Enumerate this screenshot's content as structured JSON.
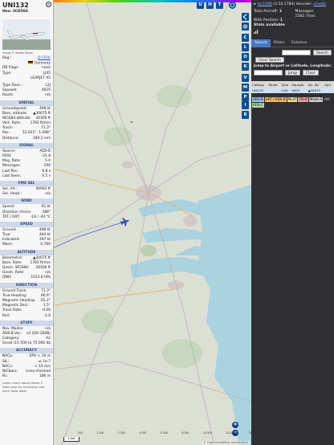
{
  "details": {
    "callsign": "UNI132",
    "hex_label": "Hex:",
    "hex": "3CD566",
    "close_label": "×",
    "photo_credit": "Image © Stefan Bauer",
    "registration": {
      "label": "Reg.:",
      "value": "D-CIOU"
    },
    "country": "Germany",
    "db_flags": {
      "label": "DB Flags:",
      "value": "none"
    },
    "type": {
      "label": "Type:",
      "value": "LJ45"
    },
    "type_name": "LEARJET 45",
    "type_desc": {
      "label": "Type Desc.:",
      "value": "L2J"
    },
    "squawk": {
      "label": "Squawk:",
      "value": "4625"
    },
    "route": {
      "label": "Route:",
      "value": "n/a"
    },
    "sections": {
      "spatial": "SPATIAL",
      "signal": "SIGNAL",
      "fms": "FMS SEL",
      "wind": "WIND",
      "speed": "SPEED",
      "altitude": "ALTITUDE",
      "direction": "DIRECTION",
      "stuff": "STUFF",
      "accuracy": "ACCURACY"
    },
    "spatial": [
      {
        "label": "Groundspeed:",
        "value": "498 kt"
      },
      {
        "label": "Baro. altitude:",
        "value": "▲30075 ft"
      },
      {
        "label": "WGS84 altitude:",
        "value": "30300 ft"
      },
      {
        "label": "Vert. Rate:",
        "value": "1792 ft/min"
      },
      {
        "label": "Track:",
        "value": "71.3°"
      },
      {
        "label": "Pos.:",
        "value": "52.021°, 1.098°"
      },
      {
        "label": "Distance:",
        "value": "189.2 nmi"
      }
    ],
    "signal": [
      {
        "label": "Source:",
        "value": "ADS-B"
      },
      {
        "label": "RSSI:",
        "value": "-21.8"
      },
      {
        "label": "Msg. Rate:",
        "value": "5.0"
      },
      {
        "label": "Messages:",
        "value": "296"
      },
      {
        "label": "Last Pos.:",
        "value": "6.8 s"
      },
      {
        "label": "Last Seen:",
        "value": "0.5 s"
      }
    ],
    "fms": [
      {
        "label": "Sel. Alt.:",
        "value": "40992 ft"
      },
      {
        "label": "Sel. Head.:",
        "value": "n/a"
      }
    ],
    "wind": [
      {
        "label": "Speed:",
        "value": "61 kt"
      },
      {
        "label": "Direction (from):",
        "value": "288°"
      },
      {
        "label": "TAT / OAT:",
        "value": "-16 / -44 °C"
      }
    ],
    "speed": [
      {
        "label": "Ground:",
        "value": "498 kt"
      },
      {
        "label": "True:",
        "value": "444 kt"
      },
      {
        "label": "Indicated:",
        "value": "297 kt"
      },
      {
        "label": "Mach:",
        "value": "0.760"
      }
    ],
    "altitude": [
      {
        "label": "Barometric:",
        "value": "▲30075 ft"
      },
      {
        "label": "Baro. Rate:",
        "value": "1792 ft/min"
      },
      {
        "label": "Geom. WGS84:",
        "value": "30300 ft"
      },
      {
        "label": "Geom. Rate:",
        "value": "n/a"
      },
      {
        "label": "QNH:",
        "value": "1013.6 hPa"
      }
    ],
    "direction": [
      {
        "label": "Ground Track:",
        "value": "71.3°"
      },
      {
        "label": "True Heading:",
        "value": "66.6°"
      },
      {
        "label": "Magnetic Heading:",
        "value": "65.2°"
      },
      {
        "label": "Magnetic Decl.:",
        "value": "1.5°"
      },
      {
        "label": "Track Rate:",
        "value": "-0.06"
      },
      {
        "label": "Roll:",
        "value": "-2.8"
      }
    ],
    "stuff": [
      {
        "label": "Nav. Modes:",
        "value": "n/a"
      },
      {
        "label": "ADS-B Ver.:",
        "value": "v2 (DO-260B)"
      },
      {
        "label": "Category:",
        "value": "A2"
      },
      {
        "label": "Small (15 500 to 75 000 lb)",
        "value": ""
      }
    ],
    "accuracy": [
      {
        "label": "NACp:",
        "value": "EPU < 10 m"
      },
      {
        "label": "SIL:",
        "value": "≤ 1e-7"
      },
      {
        "label": "NACv:",
        "value": "< 10 m/s"
      },
      {
        "label": "NICbaro:",
        "value": "cross-checked"
      },
      {
        "label": "Rc:",
        "value": "186 m"
      }
    ],
    "footer": "Learn more about Mode S data type by hovering over each data label."
  },
  "map": {
    "top_buttons": [
      "U",
      "H",
      "T"
    ],
    "side_buttons": [
      "C",
      "L",
      "O",
      "K",
      "V",
      "M",
      "P",
      "I",
      "R"
    ],
    "zoom_in": "+",
    "zoom_out": "−",
    "scale_label": "1 km",
    "attribution": "© OpenStreetMap contributors.",
    "altitude_scale_labels": [
      "500",
      "1 000",
      "2 000",
      "4 000",
      "6 000",
      "8 000",
      "10 000",
      "20 000",
      "30 000",
      "40 000+"
    ]
  },
  "stats": {
    "version_prefix": "tar1090",
    "version": "(3.14.1784)",
    "decoder_label": "decoder:",
    "decoder_value": "readsb",
    "total_aircraft_label": "Total Aircraft:",
    "total_aircraft": "1",
    "messages_label": "Messages:",
    "messages": "1582.7/sec",
    "with_position_label": "With Position:",
    "with_position": "1",
    "stats_label": "Stats available",
    "tabs": [
      "Search",
      "Filters",
      "Columns"
    ],
    "search_placeholder": "",
    "search_button": "Search",
    "clear_search_button": "Clear Search",
    "jump_label": "Jump to Airport or Latitude, Longitude:",
    "jump_button": "Jump",
    "clear_button": "Clear"
  },
  "table": {
    "headers": [
      "Callsign",
      "Route",
      "Type",
      "Squawk",
      "Alt. (ft)",
      "Spd."
    ],
    "rows": [
      [
        "UNI132",
        "",
        "LJ45",
        "4625",
        "▲30075",
        ""
      ]
    ]
  },
  "legend_tags": [
    {
      "label": "ADS-B",
      "color": "#9ec1f0"
    },
    {
      "label": "UAT / ADS-R",
      "color": "#f0b85a"
    },
    {
      "label": "MLAT",
      "color": "#f3e08a"
    },
    {
      "label": "TIS-B",
      "color": "#e7a2a2"
    },
    {
      "label": "Mode-S",
      "color": "#cccccc"
    },
    {
      "label": "AIS",
      "color": "#2f2f33"
    },
    {
      "label": "ADS-C",
      "color": "#aee0a0"
    }
  ],
  "colors": {
    "accent": "#004f9a",
    "section_header": "#cfd9ea",
    "panel_dark": "#2f2f33",
    "selected_row": "#cfe0f5"
  }
}
